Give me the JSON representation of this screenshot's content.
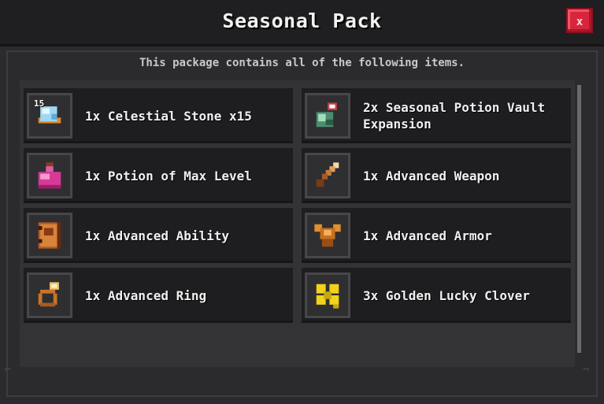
{
  "window": {
    "title": "Seasonal Pack",
    "close_label": "x",
    "subtitle": "This package contains all of the following items."
  },
  "items": [
    {
      "label": "1x Celestial Stone x15",
      "badge": "15",
      "icon": "celestial-stone-icon"
    },
    {
      "label": "2x Seasonal Potion Vault Expansion",
      "icon": "potion-vault-icon"
    },
    {
      "label": "1x Potion of Max Level",
      "icon": "max-level-potion-icon"
    },
    {
      "label": "1x Advanced Weapon",
      "icon": "sword-icon"
    },
    {
      "label": "1x Advanced Ability",
      "icon": "spellbook-icon"
    },
    {
      "label": "1x Advanced Armor",
      "icon": "armor-icon"
    },
    {
      "label": "1x Advanced Ring",
      "icon": "ring-icon"
    },
    {
      "label": "3x Golden Lucky Clover",
      "icon": "clover-icon"
    }
  ],
  "colors": {
    "close_button": "#d9253b",
    "item_background": "#1e1e20",
    "window_background": "#2b2b2d"
  }
}
